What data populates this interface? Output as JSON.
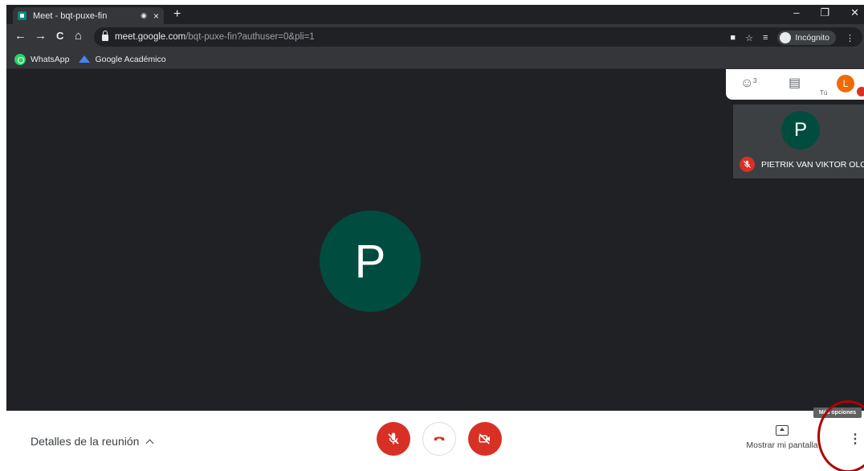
{
  "browser": {
    "tab": {
      "title": "Meet - bqt-puxe-fin",
      "record_indicator": "◉",
      "close": "×"
    },
    "new_tab": "+",
    "window_controls": {
      "minimize": "–",
      "restore": "❐",
      "close": "✕"
    },
    "nav": {
      "back": "←",
      "forward": "→",
      "reload": "C",
      "home": "⌂"
    },
    "url": {
      "host": "meet.google.com",
      "path": "/bqt-puxe-fin?authuser=0&pli=1"
    },
    "omnibox_icons": {
      "camera": "■",
      "star": "☆",
      "reading_list": "≡",
      "menu": "⋮"
    },
    "incognito_label": "Incógnito",
    "bookmarks": [
      {
        "label": "WhatsApp",
        "icon": "whatsapp-icon"
      },
      {
        "label": "Google Académico",
        "icon": "graduation-cap-icon"
      }
    ]
  },
  "meet": {
    "main_participant_initial": "P",
    "top_panel": {
      "people_icon": "☺",
      "people_count": "3",
      "chat_icon": "▤",
      "self_label": "Tú",
      "self_initial": "L"
    },
    "tile": {
      "initial": "P",
      "name": "PIETRIK VAN VIKTOR OLO"
    },
    "bottom_bar": {
      "details_label": "Detalles de la reunión",
      "present_label": "Mostrar mi pantalla",
      "more_tooltip": "Más opciones",
      "more_icon": "⋮"
    }
  },
  "colors": {
    "stage_bg": "#202124",
    "avatar_bg": "#004d40",
    "control_red": "#d93025",
    "self_avatar": "#ef6c00",
    "annotation": "#b00000"
  }
}
